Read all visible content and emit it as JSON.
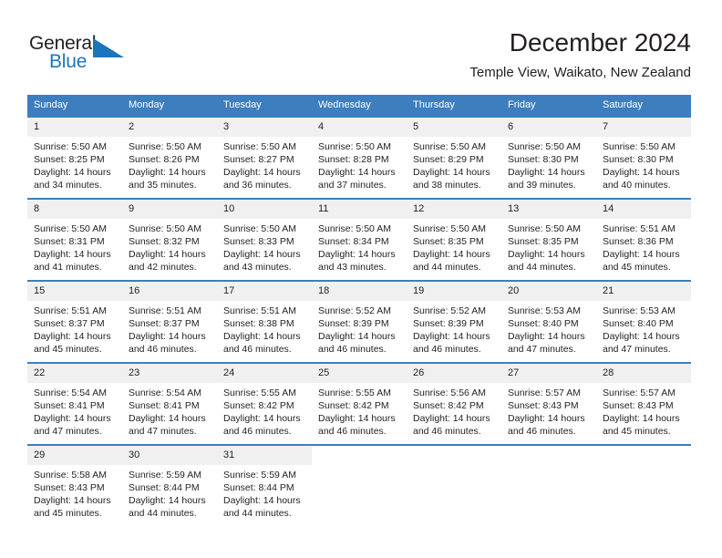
{
  "brand": {
    "word1": "General",
    "word2": "Blue",
    "accent_color": "#1b75bb"
  },
  "header": {
    "title": "December 2024",
    "subtitle": "Temple View, Waikato, New Zealand"
  },
  "calendar": {
    "header_color": "#3d7ebf",
    "daynum_bg": "#f0f0f0",
    "columns": [
      "Sunday",
      "Monday",
      "Tuesday",
      "Wednesday",
      "Thursday",
      "Friday",
      "Saturday"
    ],
    "weeks": [
      [
        {
          "day": "1",
          "sunrise": "Sunrise: 5:50 AM",
          "sunset": "Sunset: 8:25 PM",
          "daylight1": "Daylight: 14 hours",
          "daylight2": "and 34 minutes."
        },
        {
          "day": "2",
          "sunrise": "Sunrise: 5:50 AM",
          "sunset": "Sunset: 8:26 PM",
          "daylight1": "Daylight: 14 hours",
          "daylight2": "and 35 minutes."
        },
        {
          "day": "3",
          "sunrise": "Sunrise: 5:50 AM",
          "sunset": "Sunset: 8:27 PM",
          "daylight1": "Daylight: 14 hours",
          "daylight2": "and 36 minutes."
        },
        {
          "day": "4",
          "sunrise": "Sunrise: 5:50 AM",
          "sunset": "Sunset: 8:28 PM",
          "daylight1": "Daylight: 14 hours",
          "daylight2": "and 37 minutes."
        },
        {
          "day": "5",
          "sunrise": "Sunrise: 5:50 AM",
          "sunset": "Sunset: 8:29 PM",
          "daylight1": "Daylight: 14 hours",
          "daylight2": "and 38 minutes."
        },
        {
          "day": "6",
          "sunrise": "Sunrise: 5:50 AM",
          "sunset": "Sunset: 8:30 PM",
          "daylight1": "Daylight: 14 hours",
          "daylight2": "and 39 minutes."
        },
        {
          "day": "7",
          "sunrise": "Sunrise: 5:50 AM",
          "sunset": "Sunset: 8:30 PM",
          "daylight1": "Daylight: 14 hours",
          "daylight2": "and 40 minutes."
        }
      ],
      [
        {
          "day": "8",
          "sunrise": "Sunrise: 5:50 AM",
          "sunset": "Sunset: 8:31 PM",
          "daylight1": "Daylight: 14 hours",
          "daylight2": "and 41 minutes."
        },
        {
          "day": "9",
          "sunrise": "Sunrise: 5:50 AM",
          "sunset": "Sunset: 8:32 PM",
          "daylight1": "Daylight: 14 hours",
          "daylight2": "and 42 minutes."
        },
        {
          "day": "10",
          "sunrise": "Sunrise: 5:50 AM",
          "sunset": "Sunset: 8:33 PM",
          "daylight1": "Daylight: 14 hours",
          "daylight2": "and 43 minutes."
        },
        {
          "day": "11",
          "sunrise": "Sunrise: 5:50 AM",
          "sunset": "Sunset: 8:34 PM",
          "daylight1": "Daylight: 14 hours",
          "daylight2": "and 43 minutes."
        },
        {
          "day": "12",
          "sunrise": "Sunrise: 5:50 AM",
          "sunset": "Sunset: 8:35 PM",
          "daylight1": "Daylight: 14 hours",
          "daylight2": "and 44 minutes."
        },
        {
          "day": "13",
          "sunrise": "Sunrise: 5:50 AM",
          "sunset": "Sunset: 8:35 PM",
          "daylight1": "Daylight: 14 hours",
          "daylight2": "and 44 minutes."
        },
        {
          "day": "14",
          "sunrise": "Sunrise: 5:51 AM",
          "sunset": "Sunset: 8:36 PM",
          "daylight1": "Daylight: 14 hours",
          "daylight2": "and 45 minutes."
        }
      ],
      [
        {
          "day": "15",
          "sunrise": "Sunrise: 5:51 AM",
          "sunset": "Sunset: 8:37 PM",
          "daylight1": "Daylight: 14 hours",
          "daylight2": "and 45 minutes."
        },
        {
          "day": "16",
          "sunrise": "Sunrise: 5:51 AM",
          "sunset": "Sunset: 8:37 PM",
          "daylight1": "Daylight: 14 hours",
          "daylight2": "and 46 minutes."
        },
        {
          "day": "17",
          "sunrise": "Sunrise: 5:51 AM",
          "sunset": "Sunset: 8:38 PM",
          "daylight1": "Daylight: 14 hours",
          "daylight2": "and 46 minutes."
        },
        {
          "day": "18",
          "sunrise": "Sunrise: 5:52 AM",
          "sunset": "Sunset: 8:39 PM",
          "daylight1": "Daylight: 14 hours",
          "daylight2": "and 46 minutes."
        },
        {
          "day": "19",
          "sunrise": "Sunrise: 5:52 AM",
          "sunset": "Sunset: 8:39 PM",
          "daylight1": "Daylight: 14 hours",
          "daylight2": "and 46 minutes."
        },
        {
          "day": "20",
          "sunrise": "Sunrise: 5:53 AM",
          "sunset": "Sunset: 8:40 PM",
          "daylight1": "Daylight: 14 hours",
          "daylight2": "and 47 minutes."
        },
        {
          "day": "21",
          "sunrise": "Sunrise: 5:53 AM",
          "sunset": "Sunset: 8:40 PM",
          "daylight1": "Daylight: 14 hours",
          "daylight2": "and 47 minutes."
        }
      ],
      [
        {
          "day": "22",
          "sunrise": "Sunrise: 5:54 AM",
          "sunset": "Sunset: 8:41 PM",
          "daylight1": "Daylight: 14 hours",
          "daylight2": "and 47 minutes."
        },
        {
          "day": "23",
          "sunrise": "Sunrise: 5:54 AM",
          "sunset": "Sunset: 8:41 PM",
          "daylight1": "Daylight: 14 hours",
          "daylight2": "and 47 minutes."
        },
        {
          "day": "24",
          "sunrise": "Sunrise: 5:55 AM",
          "sunset": "Sunset: 8:42 PM",
          "daylight1": "Daylight: 14 hours",
          "daylight2": "and 46 minutes."
        },
        {
          "day": "25",
          "sunrise": "Sunrise: 5:55 AM",
          "sunset": "Sunset: 8:42 PM",
          "daylight1": "Daylight: 14 hours",
          "daylight2": "and 46 minutes."
        },
        {
          "day": "26",
          "sunrise": "Sunrise: 5:56 AM",
          "sunset": "Sunset: 8:42 PM",
          "daylight1": "Daylight: 14 hours",
          "daylight2": "and 46 minutes."
        },
        {
          "day": "27",
          "sunrise": "Sunrise: 5:57 AM",
          "sunset": "Sunset: 8:43 PM",
          "daylight1": "Daylight: 14 hours",
          "daylight2": "and 46 minutes."
        },
        {
          "day": "28",
          "sunrise": "Sunrise: 5:57 AM",
          "sunset": "Sunset: 8:43 PM",
          "daylight1": "Daylight: 14 hours",
          "daylight2": "and 45 minutes."
        }
      ],
      [
        {
          "day": "29",
          "sunrise": "Sunrise: 5:58 AM",
          "sunset": "Sunset: 8:43 PM",
          "daylight1": "Daylight: 14 hours",
          "daylight2": "and 45 minutes."
        },
        {
          "day": "30",
          "sunrise": "Sunrise: 5:59 AM",
          "sunset": "Sunset: 8:44 PM",
          "daylight1": "Daylight: 14 hours",
          "daylight2": "and 44 minutes."
        },
        {
          "day": "31",
          "sunrise": "Sunrise: 5:59 AM",
          "sunset": "Sunset: 8:44 PM",
          "daylight1": "Daylight: 14 hours",
          "daylight2": "and 44 minutes."
        },
        {
          "day": "",
          "sunrise": "",
          "sunset": "",
          "daylight1": "",
          "daylight2": ""
        },
        {
          "day": "",
          "sunrise": "",
          "sunset": "",
          "daylight1": "",
          "daylight2": ""
        },
        {
          "day": "",
          "sunrise": "",
          "sunset": "",
          "daylight1": "",
          "daylight2": ""
        },
        {
          "day": "",
          "sunrise": "",
          "sunset": "",
          "daylight1": "",
          "daylight2": ""
        }
      ]
    ]
  }
}
